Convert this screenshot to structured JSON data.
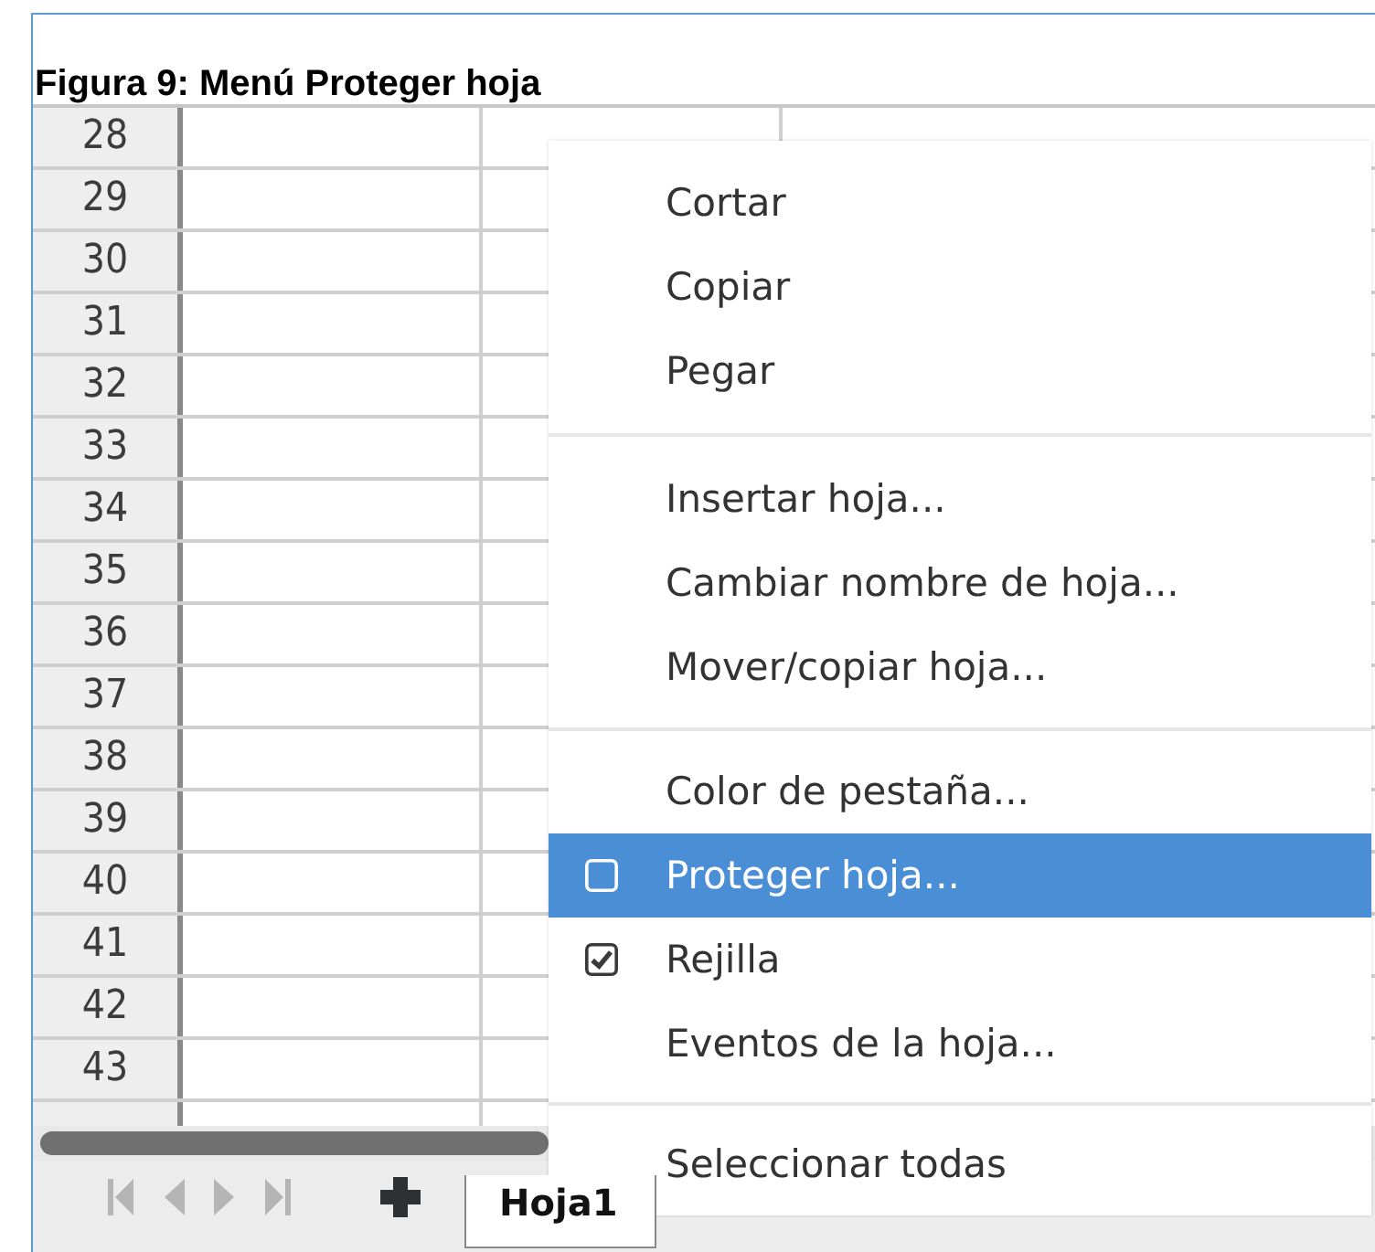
{
  "caption": "Figura 9: Menú Proteger hoja",
  "sheet": {
    "row_numbers": [
      "28",
      "29",
      "30",
      "31",
      "32",
      "33",
      "34",
      "35",
      "36",
      "37",
      "38",
      "39",
      "40",
      "41",
      "42",
      "43"
    ],
    "tabs": [
      {
        "label": "Hoja1",
        "selected": true
      }
    ]
  },
  "context_menu": {
    "items": [
      {
        "kind": "command",
        "label": "Cortar",
        "selected": false
      },
      {
        "kind": "command",
        "label": "Copiar",
        "selected": false
      },
      {
        "kind": "command",
        "label": "Pegar",
        "selected": false
      },
      {
        "kind": "separator"
      },
      {
        "kind": "command",
        "label": "Insertar hoja...",
        "selected": false
      },
      {
        "kind": "command",
        "label": "Cambiar nombre de hoja...",
        "selected": false
      },
      {
        "kind": "command",
        "label": "Mover/copiar hoja...",
        "selected": false
      },
      {
        "kind": "separator"
      },
      {
        "kind": "command",
        "label": "Color de pestaña...",
        "selected": false
      },
      {
        "kind": "check",
        "label": "Proteger hoja...",
        "checked": false,
        "selected": true
      },
      {
        "kind": "check",
        "label": "Rejilla",
        "checked": true,
        "selected": false
      },
      {
        "kind": "command",
        "label": "Eventos de la hoja...",
        "selected": false
      },
      {
        "kind": "separator"
      },
      {
        "kind": "command",
        "label": "Seleccionar todas",
        "selected": false
      }
    ]
  }
}
